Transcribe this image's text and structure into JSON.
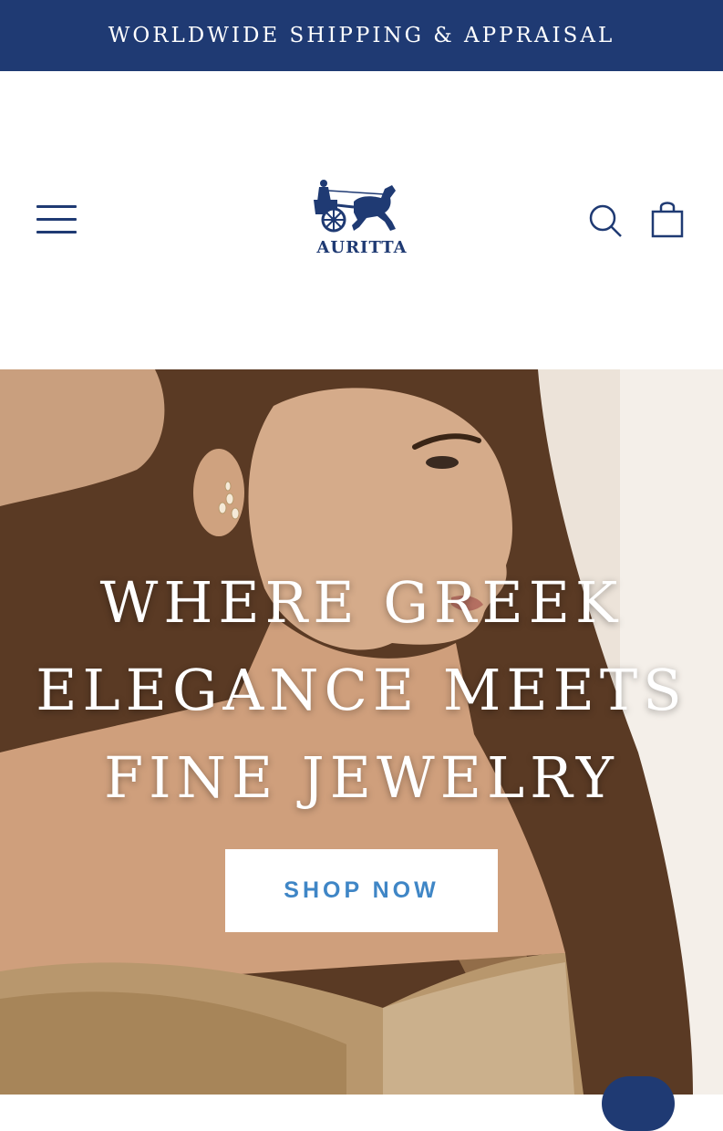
{
  "announcement": {
    "text": "WORLDWIDE SHIPPING & APPRAISAL"
  },
  "header": {
    "brand": "AURITTA",
    "icons": {
      "menu": "hamburger-menu-icon",
      "search": "search-icon",
      "cart": "shopping-bag-icon"
    }
  },
  "hero": {
    "title": "WHERE GREEK ELEGANCE MEETS FINE JEWELRY",
    "cta": "SHOP NOW"
  },
  "colors": {
    "brand_navy": "#1f3a73",
    "cta_text": "#3f86c6",
    "hero_text": "#ffffff"
  }
}
